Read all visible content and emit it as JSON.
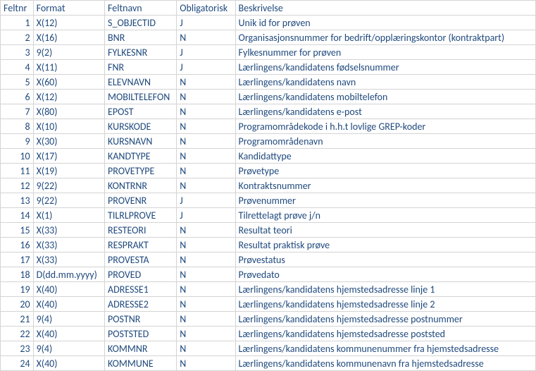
{
  "headers": {
    "feltnr": "Feltnr",
    "format": "Format",
    "feltnavn": "Feltnavn",
    "obligatorisk": "Obligatorisk",
    "beskrivelse": "Beskrivelse"
  },
  "rows": [
    {
      "feltnr": "1",
      "format": "X(12)",
      "feltnavn": "S_OBJECTID",
      "oblig": "J",
      "besk": "Unik id for prøven"
    },
    {
      "feltnr": "2",
      "format": "X(16)",
      "feltnavn": "BNR",
      "oblig": "N",
      "besk": "Organisasjonsnummer for bedrift/opplæringskontor (kontraktpart)"
    },
    {
      "feltnr": "3",
      "format": "9(2)",
      "feltnavn": "FYLKESNR",
      "oblig": "J",
      "besk": "Fylkesnummer for prøven"
    },
    {
      "feltnr": "4",
      "format": "X(11)",
      "feltnavn": "FNR",
      "oblig": "J",
      "besk": "Lærlingens/kandidatens fødselsnummer"
    },
    {
      "feltnr": "5",
      "format": "X(60)",
      "feltnavn": "ELEVNAVN",
      "oblig": "N",
      "besk": "Lærlingens/kandidatens navn"
    },
    {
      "feltnr": "6",
      "format": "X(12)",
      "feltnavn": "MOBILTELEFON",
      "oblig": "N",
      "besk": "Lærlingens/kandidatens mobiltelefon"
    },
    {
      "feltnr": "7",
      "format": "X(80)",
      "feltnavn": "EPOST",
      "oblig": "N",
      "besk": "Lærlingens/kandidatens e-post"
    },
    {
      "feltnr": "8",
      "format": "X(10)",
      "feltnavn": "KURSKODE",
      "oblig": "N",
      "besk": "Programområdekode i h.h.t lovlige GREP-koder"
    },
    {
      "feltnr": "9",
      "format": "X(30)",
      "feltnavn": "KURSNAVN",
      "oblig": "N",
      "besk": "Programområdenavn"
    },
    {
      "feltnr": "10",
      "format": "X(17)",
      "feltnavn": "KANDTYPE",
      "oblig": "N",
      "besk": "Kandidattype"
    },
    {
      "feltnr": "11",
      "format": "X(19)",
      "feltnavn": "PROVETYPE",
      "oblig": "N",
      "besk": "Prøvetype"
    },
    {
      "feltnr": "12",
      "format": "9(22)",
      "feltnavn": "KONTRNR",
      "oblig": "N",
      "besk": "Kontraktsnummer"
    },
    {
      "feltnr": "13",
      "format": "9(22)",
      "feltnavn": "PROVENR",
      "oblig": "J",
      "besk": "Prøvenummer"
    },
    {
      "feltnr": "14",
      "format": "X(1)",
      "feltnavn": "TILRLPROVE",
      "oblig": "J",
      "besk": "Tilrettelagt prøve j/n"
    },
    {
      "feltnr": "15",
      "format": "X(33)",
      "feltnavn": "RESTEORI",
      "oblig": "N",
      "besk": "Resultat teori"
    },
    {
      "feltnr": "16",
      "format": "X(33)",
      "feltnavn": "RESPRAKT",
      "oblig": "N",
      "besk": "Resultat praktisk prøve"
    },
    {
      "feltnr": "17",
      "format": "X(33)",
      "feltnavn": "PROVESTA",
      "oblig": "N",
      "besk": "Prøvestatus"
    },
    {
      "feltnr": "18",
      "format": "D(dd.mm.yyyy)",
      "feltnavn": "PROVED",
      "oblig": "N",
      "besk": "Prøvedato"
    },
    {
      "feltnr": "19",
      "format": "X(40)",
      "feltnavn": "ADRESSE1",
      "oblig": "N",
      "besk": "Lærlingens/kandidatens hjemstedsadresse linje 1"
    },
    {
      "feltnr": "20",
      "format": "X(40)",
      "feltnavn": "ADRESSE2",
      "oblig": "N",
      "besk": "Lærlingens/kandidatens hjemstedsadresse linje 2"
    },
    {
      "feltnr": "21",
      "format": "9(4)",
      "feltnavn": "POSTNR",
      "oblig": "N",
      "besk": "Lærlingens/kandidatens hjemstedsadresse postnummer"
    },
    {
      "feltnr": "22",
      "format": "X(40)",
      "feltnavn": "POSTSTED",
      "oblig": "N",
      "besk": "Lærlingens/kandidatens hjemstedsadresse poststed"
    },
    {
      "feltnr": "23",
      "format": "9(4)",
      "feltnavn": "KOMMNR",
      "oblig": "N",
      "besk": "Lærlingens/kandidatens kommunenummer fra hjemstedsadresse"
    },
    {
      "feltnr": "24",
      "format": "X(40)",
      "feltnavn": "KOMMUNE",
      "oblig": "N",
      "besk": "Lærlingens/kandidatens kommunenavn fra hjemstedsadresse"
    }
  ]
}
